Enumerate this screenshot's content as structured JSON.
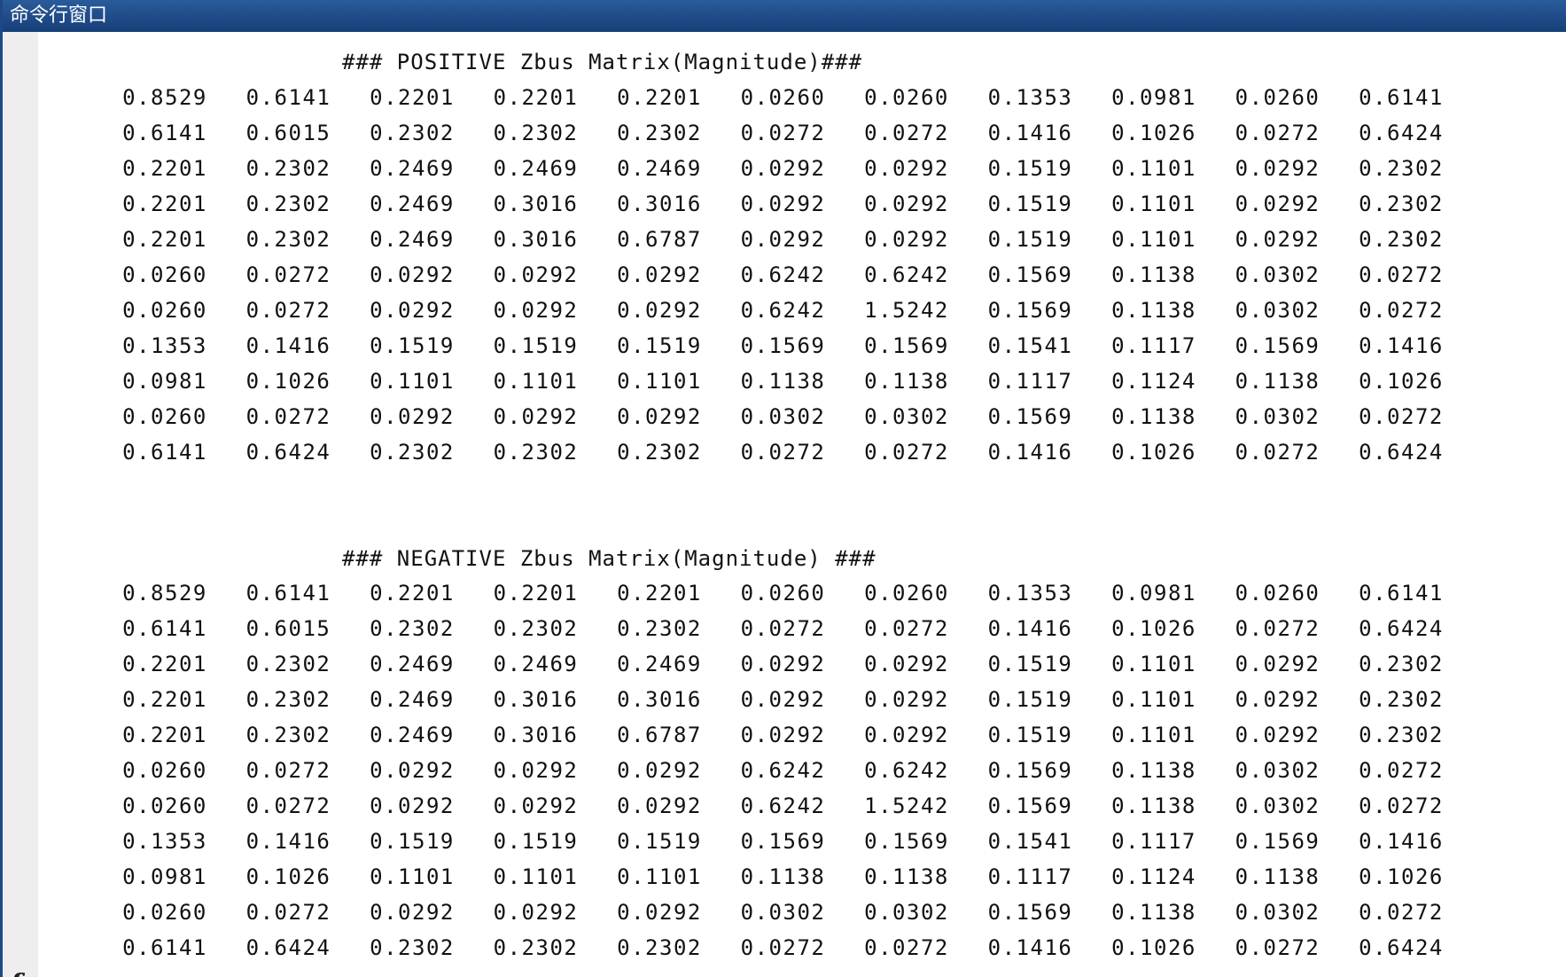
{
  "window": {
    "title": "命令行窗口"
  },
  "prompt": {
    "icon": "fx-icon"
  },
  "positive": {
    "title": "### POSITIVE Zbus Matrix(Magnitude)###",
    "rows": [
      [
        "0.8529",
        "0.6141",
        "0.2201",
        "0.2201",
        "0.2201",
        "0.0260",
        "0.0260",
        "0.1353",
        "0.0981",
        "0.0260",
        "0.6141"
      ],
      [
        "0.6141",
        "0.6015",
        "0.2302",
        "0.2302",
        "0.2302",
        "0.0272",
        "0.0272",
        "0.1416",
        "0.1026",
        "0.0272",
        "0.6424"
      ],
      [
        "0.2201",
        "0.2302",
        "0.2469",
        "0.2469",
        "0.2469",
        "0.0292",
        "0.0292",
        "0.1519",
        "0.1101",
        "0.0292",
        "0.2302"
      ],
      [
        "0.2201",
        "0.2302",
        "0.2469",
        "0.3016",
        "0.3016",
        "0.0292",
        "0.0292",
        "0.1519",
        "0.1101",
        "0.0292",
        "0.2302"
      ],
      [
        "0.2201",
        "0.2302",
        "0.2469",
        "0.3016",
        "0.6787",
        "0.0292",
        "0.0292",
        "0.1519",
        "0.1101",
        "0.0292",
        "0.2302"
      ],
      [
        "0.0260",
        "0.0272",
        "0.0292",
        "0.0292",
        "0.0292",
        "0.6242",
        "0.6242",
        "0.1569",
        "0.1138",
        "0.0302",
        "0.0272"
      ],
      [
        "0.0260",
        "0.0272",
        "0.0292",
        "0.0292",
        "0.0292",
        "0.6242",
        "1.5242",
        "0.1569",
        "0.1138",
        "0.0302",
        "0.0272"
      ],
      [
        "0.1353",
        "0.1416",
        "0.1519",
        "0.1519",
        "0.1519",
        "0.1569",
        "0.1569",
        "0.1541",
        "0.1117",
        "0.1569",
        "0.1416"
      ],
      [
        "0.0981",
        "0.1026",
        "0.1101",
        "0.1101",
        "0.1101",
        "0.1138",
        "0.1138",
        "0.1117",
        "0.1124",
        "0.1138",
        "0.1026"
      ],
      [
        "0.0260",
        "0.0272",
        "0.0292",
        "0.0292",
        "0.0292",
        "0.0302",
        "0.0302",
        "0.1569",
        "0.1138",
        "0.0302",
        "0.0272"
      ],
      [
        "0.6141",
        "0.6424",
        "0.2302",
        "0.2302",
        "0.2302",
        "0.0272",
        "0.0272",
        "0.1416",
        "0.1026",
        "0.0272",
        "0.6424"
      ]
    ]
  },
  "negative": {
    "title": "### NEGATIVE Zbus Matrix(Magnitude) ###",
    "rows": [
      [
        "0.8529",
        "0.6141",
        "0.2201",
        "0.2201",
        "0.2201",
        "0.0260",
        "0.0260",
        "0.1353",
        "0.0981",
        "0.0260",
        "0.6141"
      ],
      [
        "0.6141",
        "0.6015",
        "0.2302",
        "0.2302",
        "0.2302",
        "0.0272",
        "0.0272",
        "0.1416",
        "0.1026",
        "0.0272",
        "0.6424"
      ],
      [
        "0.2201",
        "0.2302",
        "0.2469",
        "0.2469",
        "0.2469",
        "0.0292",
        "0.0292",
        "0.1519",
        "0.1101",
        "0.0292",
        "0.2302"
      ],
      [
        "0.2201",
        "0.2302",
        "0.2469",
        "0.3016",
        "0.3016",
        "0.0292",
        "0.0292",
        "0.1519",
        "0.1101",
        "0.0292",
        "0.2302"
      ],
      [
        "0.2201",
        "0.2302",
        "0.2469",
        "0.3016",
        "0.6787",
        "0.0292",
        "0.0292",
        "0.1519",
        "0.1101",
        "0.0292",
        "0.2302"
      ],
      [
        "0.0260",
        "0.0272",
        "0.0292",
        "0.0292",
        "0.0292",
        "0.6242",
        "0.6242",
        "0.1569",
        "0.1138",
        "0.0302",
        "0.0272"
      ],
      [
        "0.0260",
        "0.0272",
        "0.0292",
        "0.0292",
        "0.0292",
        "0.6242",
        "1.5242",
        "0.1569",
        "0.1138",
        "0.0302",
        "0.0272"
      ],
      [
        "0.1353",
        "0.1416",
        "0.1519",
        "0.1519",
        "0.1519",
        "0.1569",
        "0.1569",
        "0.1541",
        "0.1117",
        "0.1569",
        "0.1416"
      ],
      [
        "0.0981",
        "0.1026",
        "0.1101",
        "0.1101",
        "0.1101",
        "0.1138",
        "0.1138",
        "0.1117",
        "0.1124",
        "0.1138",
        "0.1026"
      ],
      [
        "0.0260",
        "0.0272",
        "0.0292",
        "0.0292",
        "0.0292",
        "0.0302",
        "0.0302",
        "0.1569",
        "0.1138",
        "0.0302",
        "0.0272"
      ],
      [
        "0.6141",
        "0.6424",
        "0.2302",
        "0.2302",
        "0.2302",
        "0.0272",
        "0.0272",
        "0.1416",
        "0.1026",
        "0.0272",
        "0.6424"
      ]
    ]
  }
}
